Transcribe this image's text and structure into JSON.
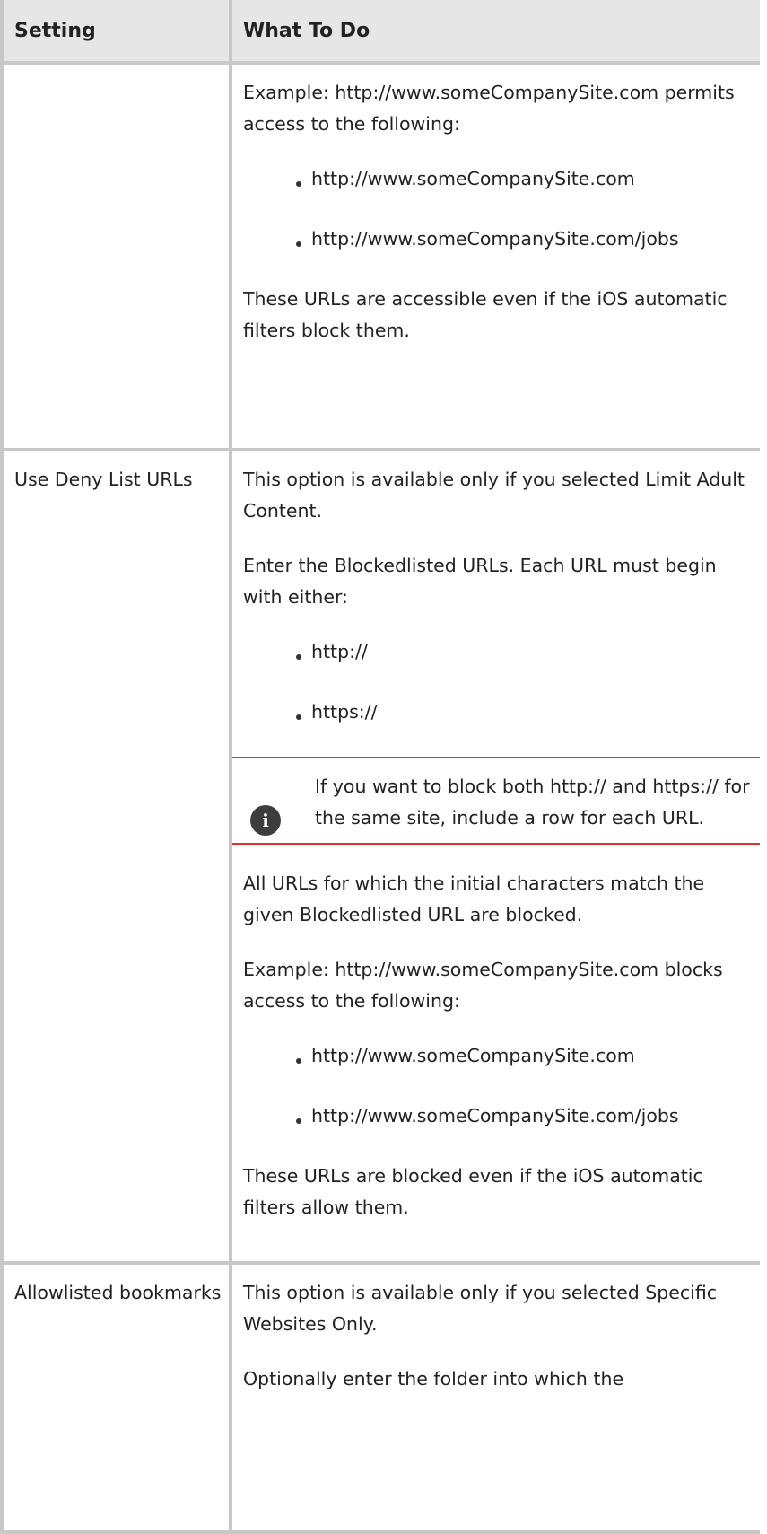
{
  "table": {
    "headers": [
      "Setting",
      "What To Do"
    ],
    "row1": {
      "setting": "",
      "p1": "Example: http://www.someCompanySite.com permits access to the following:",
      "bullets": [
        "http://www.someCompanySite.com",
        "http://www.someCompanySite.com/jobs"
      ],
      "p2": "These URLs are accessible even if the iOS automatic filters block them."
    },
    "row2": {
      "setting": "Use Deny List URLs",
      "p1": "This option is available only if you selected Limit Adult Content.",
      "p2": "Enter the Blockedlisted URLs. Each URL must begin with either:",
      "bullets1": [
        "http://",
        "https://"
      ],
      "note": "If you want to block both http:// and https:// for the same site, include a row for each URL.",
      "p3": "All URLs for which the initial characters match the given Blockedlisted URL are blocked.",
      "p4": "Example: http://www.someCompanySite.com blocks access to the following:",
      "bullets2": [
        "http://www.someCompanySite.com",
        "http://www.someCompanySite.com/jobs"
      ],
      "p5": "These URLs are blocked even if the iOS automatic filters allow them."
    },
    "row3": {
      "setting": "Allowlisted bookmarks",
      "p1": "This option is available only if you selected Specific Websites Only.",
      "p2": "Optionally enter the folder into which the"
    }
  },
  "icons": {
    "note_icon": "info-icon"
  },
  "colors": {
    "header_bg": "#e6e6e6",
    "border": "#c8c8c8",
    "note_rule": "#e03530"
  }
}
